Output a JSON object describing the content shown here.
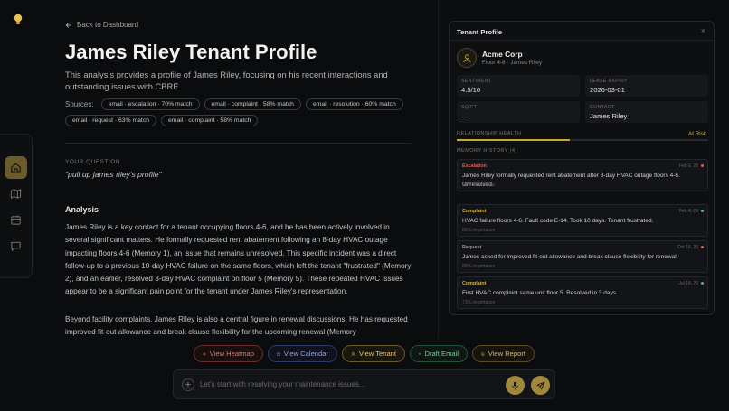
{
  "nav": {
    "back_label": "Back to Dashboard",
    "rail_items": [
      "home-icon",
      "map-icon",
      "calendar-icon",
      "chat-icon"
    ]
  },
  "header": {
    "title": "James Riley Tenant Profile",
    "subtitle": "This analysis provides a profile of James Riley, focusing on his recent interactions and outstanding issues with CBRE."
  },
  "sources": {
    "label": "Sources:",
    "chips": [
      "email · escalation · 70% match",
      "email · complaint · 58% match",
      "email · resolution · 60% match",
      "email · request · 63% match",
      "email · complaint · 58% match"
    ]
  },
  "question": {
    "label": "YOUR QUESTION",
    "text": "\"pull up james riley's profile\""
  },
  "analysis": {
    "heading": "Analysis",
    "paragraph1": "James Riley is a key contact for a tenant occupying floors 4-6, and he has been actively involved in several significant matters. He formally requested rent abatement following an 8-day HVAC outage impacting floors 4-6 (Memory 1), an issue that remains unresolved. This specific incident was a direct follow-up to a previous 10-day HVAC failure on the same floors, which left the tenant \"frustrated\" (Memory 2), and an earlier, resolved 3-day HVAC complaint on floor 5 (Memory 5). These repeated HVAC issues appear to be a significant pain point for the tenant under James Riley's representation.",
    "paragraph2": "Beyond facility complaints, James Riley is also a central figure in renewal discussions. He has requested improved fit-out allowance and break clause flexibility for the upcoming renewal (Memory"
  },
  "panel": {
    "title": "Tenant Profile",
    "close": "×",
    "company": "Acme Corp",
    "floor": "Floor 4-6 · James Riley",
    "stats": [
      {
        "label": "SENTIMENT",
        "value": "4.5/10"
      },
      {
        "label": "LEASE EXPIRY",
        "value": "2026-03-01"
      },
      {
        "label": "SQ FT",
        "value": "—"
      },
      {
        "label": "CONTACT",
        "value": "James Riley"
      }
    ],
    "relationship_label": "RELATIONSHIP HEALTH",
    "relationship_status": "At Risk",
    "relationship_level": 0.45,
    "memory_label": "MEMORY HISTORY (4)",
    "memories": [
      {
        "type": "Escalation",
        "date": "Feb 6, 26",
        "text": "James Riley formally requested rent abatement after 8-day HVAC outage floors 4-6. Unresolved.",
        "importance": "94% importance",
        "color": "#e0604f"
      },
      {
        "type": "Complaint",
        "date": "Feb 4, 26",
        "text": "HVAC failure floors 4-6. Fault code E-14. Took 10 days. Tenant frustrated.",
        "importance": "86% importance",
        "color": "#d6b443"
      },
      {
        "type": "Request",
        "date": "Oct 16, 25",
        "text": "James asked for improved fit-out allowance and break clause flexibility for renewal.",
        "importance": "80% importance",
        "color": "#9a9a9a"
      },
      {
        "type": "Complaint",
        "date": "Jul 18, 25",
        "text": "First HVAC complaint same unit floor 5. Resolved in 3 days.",
        "importance": "71% importance",
        "color": "#d6b443"
      }
    ]
  },
  "actions": {
    "heatmap": "View Heatmap",
    "calendar": "View Calendar",
    "tenant": "View Tenant",
    "email": "Draft Email",
    "report": "View Report"
  },
  "composer": {
    "placeholder": "Let's start with resolving your maintenance issues..."
  },
  "colors": {
    "accent": "#c9a53a",
    "escalation": "#e0604f",
    "complaint_dot": "#4fbf7a"
  }
}
